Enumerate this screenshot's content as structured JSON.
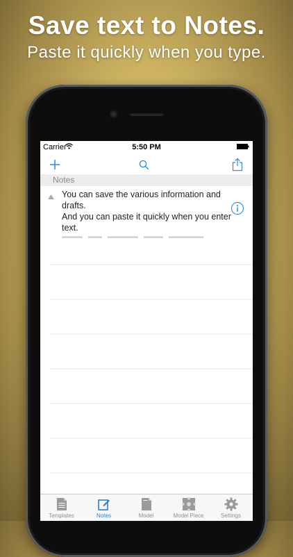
{
  "promo": {
    "title": "Save text to Notes.",
    "subtitle": "Paste it quickly when you type."
  },
  "status": {
    "carrier": "Carrier",
    "time": "5:50 PM"
  },
  "nav": {
    "add_icon": "plus-icon",
    "search_icon": "search-icon",
    "share_icon": "share-icon",
    "accent": "#3a8ee0"
  },
  "section": {
    "header": "Notes"
  },
  "notes": [
    {
      "line1": "You can save the various information and",
      "line2": "drafts.",
      "line3": "And you can paste it quickly when you enter",
      "line4": "text."
    }
  ],
  "tabs": [
    {
      "label": "Templates",
      "icon": "document-icon"
    },
    {
      "label": "Notes",
      "icon": "compose-icon",
      "active": true
    },
    {
      "label": "Model",
      "icon": "page-icon"
    },
    {
      "label": "Model Piece",
      "icon": "puzzle-icon"
    },
    {
      "label": "Settings",
      "icon": "gear-icon"
    }
  ]
}
